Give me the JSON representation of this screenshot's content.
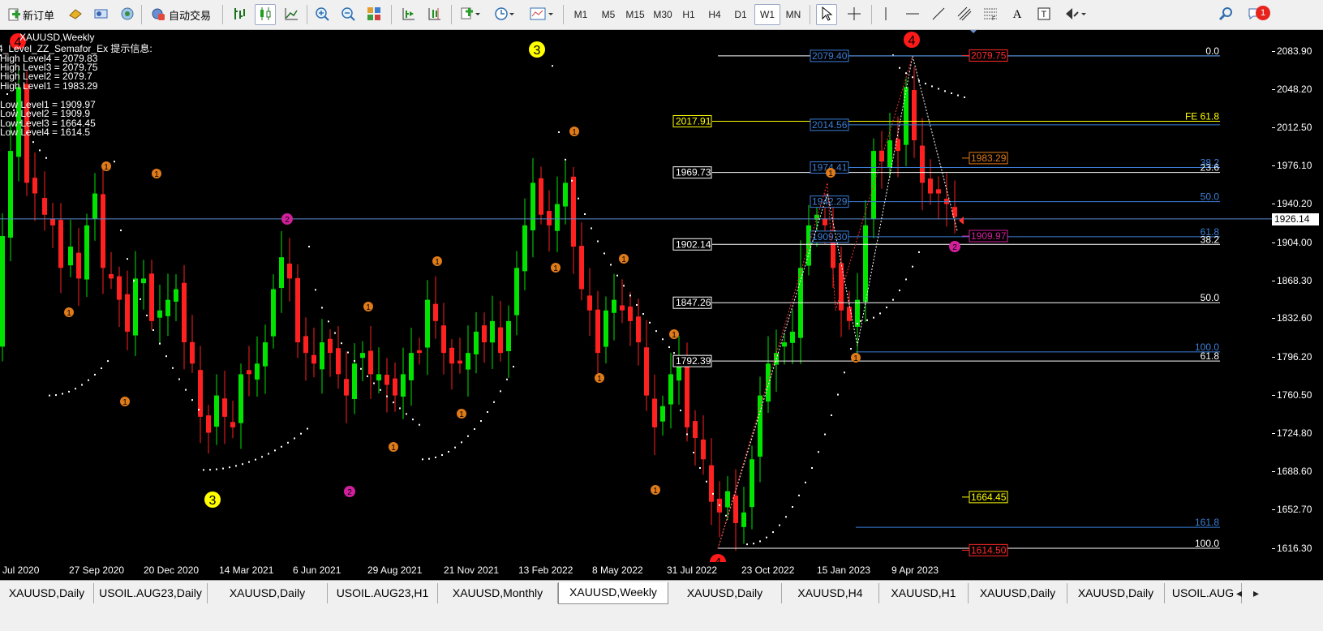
{
  "toolbar": {
    "new_order_label": "新订单",
    "auto_trade_label": "自动交易",
    "timeframes": [
      "M1",
      "M5",
      "M15",
      "M30",
      "H1",
      "H4",
      "D1",
      "W1",
      "MN"
    ],
    "active_timeframe": "W1",
    "notification_count": "1"
  },
  "chart": {
    "symbol_title": "XAUUSD,Weekly",
    "indicator_title": "4_Level_ZZ_Semafor_Ex 提示信息:",
    "info_lines": [
      "High Level4 = 2079.83",
      "High Level3 = 2079.75",
      "High Level2 = 2079.7",
      "High Level1 = 1983.29",
      "",
      "Low Level1 = 1909.97",
      "Low Level2 = 1909.9",
      "Low Level3 = 1664.45",
      "Low Level4 = 1614.5"
    ],
    "current_price": "1926.14",
    "price_levels": [
      "2083.90",
      "2048.20",
      "2012.50",
      "1976.10",
      "1940.20",
      "1904.00",
      "1868.30",
      "1832.60",
      "1796.20",
      "1760.50",
      "1724.80",
      "1688.60",
      "1652.70",
      "1616.30"
    ],
    "time_labels": [
      "Jul 2020",
      "27 Sep 2020",
      "20 Dec 2020",
      "14 Mar 2021",
      "6 Jun 2021",
      "29 Aug 2021",
      "21 Nov 2021",
      "13 Feb 2022",
      "8 May 2022",
      "31 Jul 2022",
      "23 Oct 2022",
      "15 Jan 2023",
      "9 Apr 2023"
    ],
    "fib_left_labels": [
      "2017.91",
      "1969.73",
      "1902.14",
      "1847.26",
      "1792.39"
    ],
    "fib_blue_labels": [
      "2079.40",
      "2014.56",
      "1974.41",
      "1942.29",
      "1909.30"
    ],
    "right_boxes": [
      "2079.75",
      "1983.29",
      "1909.97",
      "1664.45",
      "1614.50"
    ],
    "fib_right_labels": [
      "0.0",
      "FE 61.8",
      "23.6",
      "38.2",
      "50.0",
      "61.8",
      "38.2",
      "50.0",
      "100.0",
      "61.8",
      "161.8",
      "100.0"
    ],
    "semafor_labels": [
      "1",
      "2",
      "3",
      "4"
    ]
  },
  "tabs": [
    "XAUUSD,Daily",
    "USOIL.AUG23,Daily",
    "XAUUSD,Daily",
    "USOIL.AUG23,H1",
    "XAUUSD,Monthly",
    "XAUUSD,Weekly",
    "XAUUSD,Daily",
    "XAUUSD,H4",
    "XAUUSD,H1",
    "XAUUSD,Daily",
    "XAUUSD,Daily",
    "USOIL.AUG"
  ],
  "active_tab": "XAUUSD,Weekly",
  "colors": {
    "bull": "#00e400",
    "bear": "#ff2020",
    "background": "#000000",
    "yellow": "#ffff00",
    "blue_line": "#3b7fd8",
    "orange": "#e07b1a",
    "magenta": "#d2209c",
    "red_marker": "#ff1a1a"
  }
}
